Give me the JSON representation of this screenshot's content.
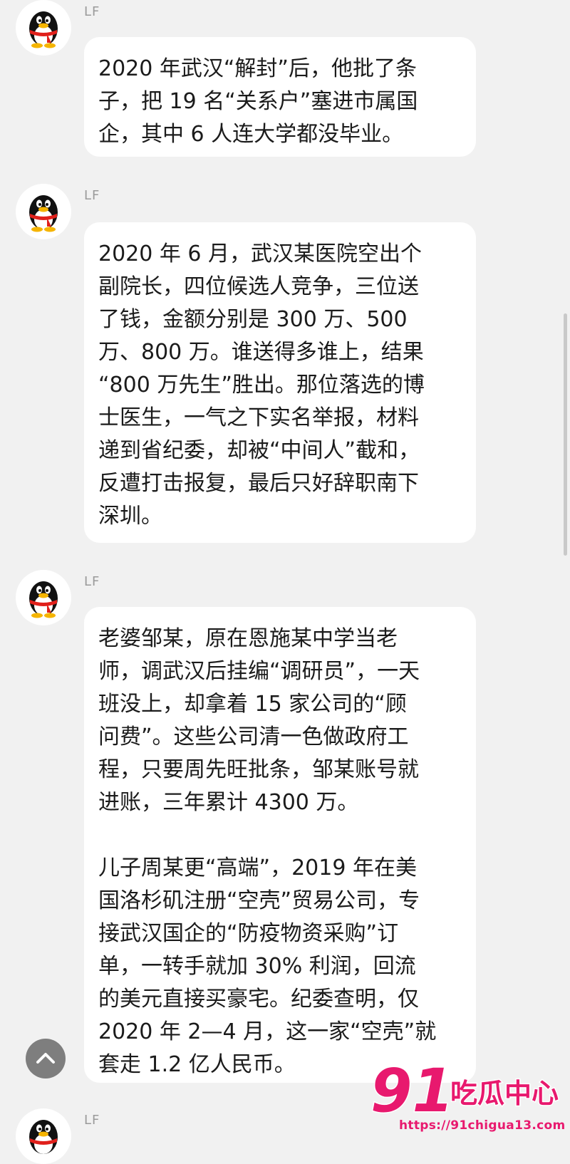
{
  "messages": [
    {
      "sender": "LF",
      "paragraphs": [
        "2020 年武汉“解封”后，他批了条\n子，把 19 名“关系户”塞进市属国\n企，其中 6 人连大学都没毕业。"
      ]
    },
    {
      "sender": "LF",
      "paragraphs": [
        "2020 年 6 月，武汉某医院空出个\n副院长，四位候选人竞争，三位送\n了钱，金额分别是 300 万、500\n万、800 万。谁送得多谁上，结果\n“800 万先生”胜出。那位落选的博\n士医生，一气之下实名举报，材料\n递到省纪委，却被“中间人”截和，\n反遭打击报复，最后只好辞职南下\n深圳。"
      ]
    },
    {
      "sender": "LF",
      "paragraphs": [
        " 老婆邹某，原在恩施某中学当老\n师，调武汉后挂编“调研员”，一天\n班没上，却拿着 15 家公司的“顾\n问费”。这些公司清一色做政府工\n程，只要周先旺批条，邹某账号就\n进账，三年累计 4300 万。",
        "儿子周某更“高端”，2019 年在美\n国洛杉矶注册“空壳”贸易公司，专\n接武汉国企的“防疫物资采购”订\n单，一转手就加 30% 利润，回流\n的美元直接买豪宅。纪委查明，仅\n2020 年 2—4 月，这一家“空壳”就\n套走 1.2 亿人民币。"
      ]
    },
    {
      "sender": "LF",
      "paragraphs": []
    }
  ],
  "icons": {
    "avatar": "qq-penguin-icon",
    "scroll_button": "chevron-up-icon"
  },
  "watermark": {
    "number": "91",
    "name": "吃瓜中心",
    "url": "https://91chigua13.com"
  },
  "colors": {
    "background": "#f1f1f1",
    "bubble": "#ffffff",
    "text": "#1b1b1b",
    "sender": "#9a9a9a",
    "watermark": "#e8196e"
  }
}
